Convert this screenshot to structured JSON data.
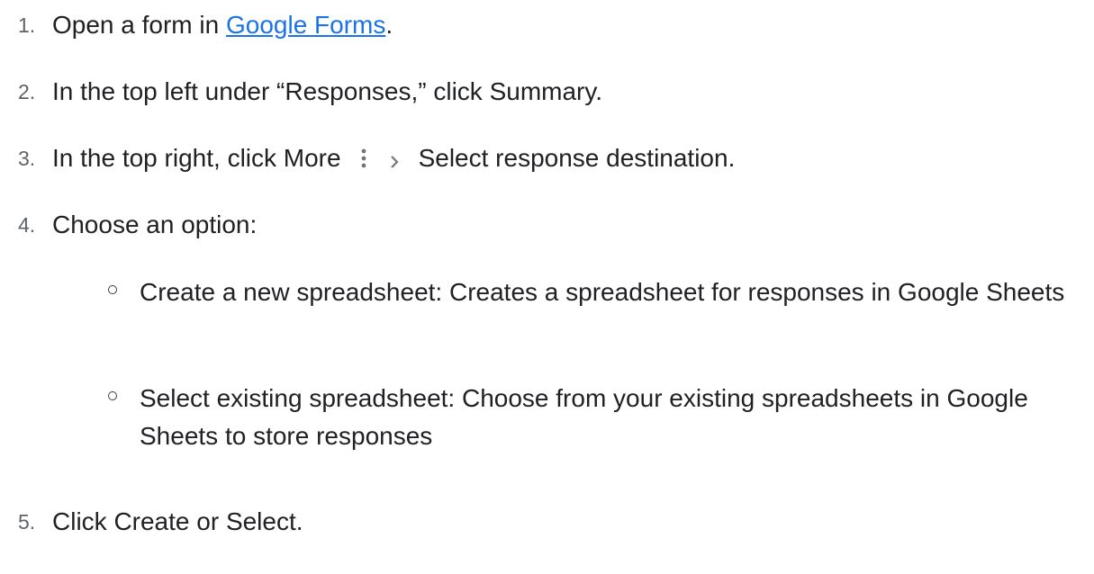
{
  "steps": [
    {
      "num": "1.",
      "before": "Open a form in ",
      "link": "Google Forms",
      "after": "."
    },
    {
      "num": "2.",
      "text": "In the top left under “Responses,” click Summary."
    },
    {
      "num": "3.",
      "before": "In the top right, click More",
      "after": "Select response destination.",
      "icons": [
        "more-vert-icon",
        "chevron-right-icon"
      ]
    },
    {
      "num": "4.",
      "text": "Choose an option:"
    },
    {
      "num": "5.",
      "text": "Click Create or Select."
    }
  ],
  "options": [
    {
      "text": "Create a new spreadsheet: Creates a spreadsheet for responses in Google Sheets"
    },
    {
      "text": "Select existing spreadsheet: Choose from your existing spreadsheets in Google Sheets to store responses"
    }
  ],
  "colors": {
    "link": "#1a73e8",
    "text": "#202124",
    "number": "#5f6368",
    "icon": "#757575"
  }
}
